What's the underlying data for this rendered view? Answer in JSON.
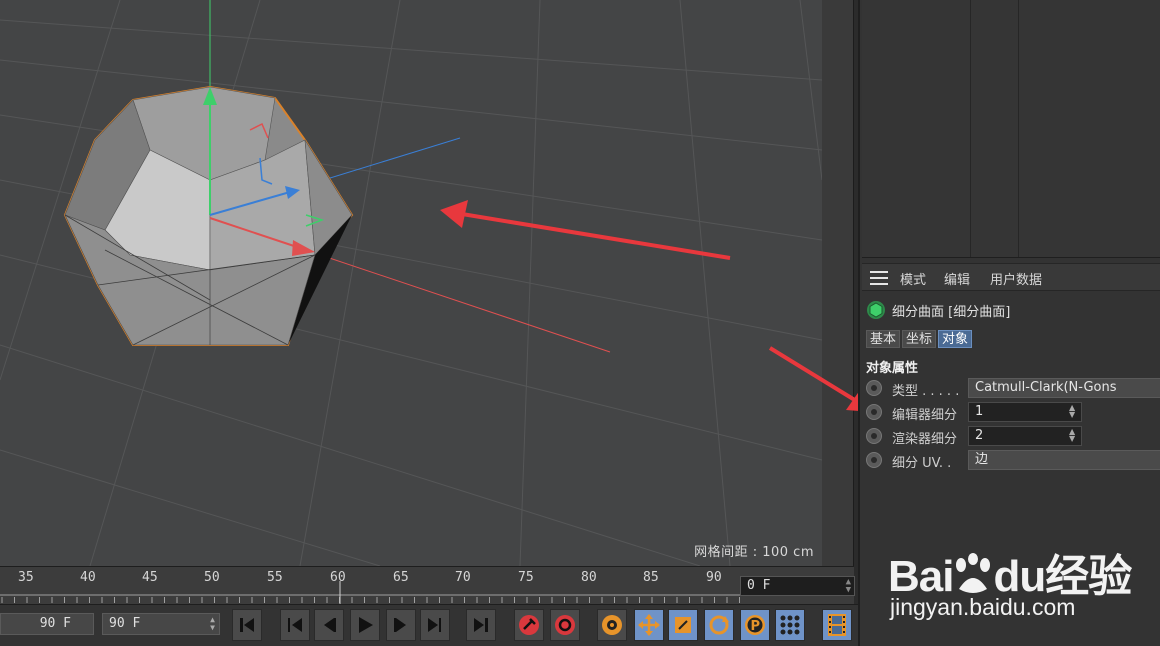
{
  "viewport": {
    "grid_spacing_label": "网格间距 : 100 cm"
  },
  "timeline": {
    "ticks": [
      "35",
      "40",
      "45",
      "50",
      "55",
      "60",
      "65",
      "70",
      "75",
      "80",
      "85",
      "90"
    ],
    "current_frame": "0 F"
  },
  "transport": {
    "start_frame": "90 F",
    "end_frame": "90 F"
  },
  "attribute_manager": {
    "menu": [
      "模式",
      "编辑",
      "用户数据"
    ],
    "object_title": "细分曲面 [细分曲面]",
    "tabs": [
      "基本",
      "坐标",
      "对象"
    ],
    "active_tab": "对象",
    "section_title": "对象属性",
    "properties": [
      {
        "label": "类型 . . . . .",
        "value": "Catmull-Clark(N-Gons"
      },
      {
        "label": "编辑器细分",
        "value": "1"
      },
      {
        "label": "渲染器细分",
        "value": "2"
      },
      {
        "label": "细分 UV. .",
        "value": "边"
      }
    ]
  },
  "watermark": {
    "brand_left": "Bai",
    "brand_mid": "du",
    "brand_right": "经验",
    "url": "jingyan.baidu.com"
  },
  "colors": {
    "viewport_bg": "#444546",
    "selection_outline": "#d9822b",
    "annotation_arrow": "#e8383d",
    "y_axis": "#3ecf6a",
    "x_axis": "#e05050",
    "z_axis": "#3a7fd6",
    "active_tab": "#4a6a94",
    "transport_active": "#6f93c8"
  }
}
